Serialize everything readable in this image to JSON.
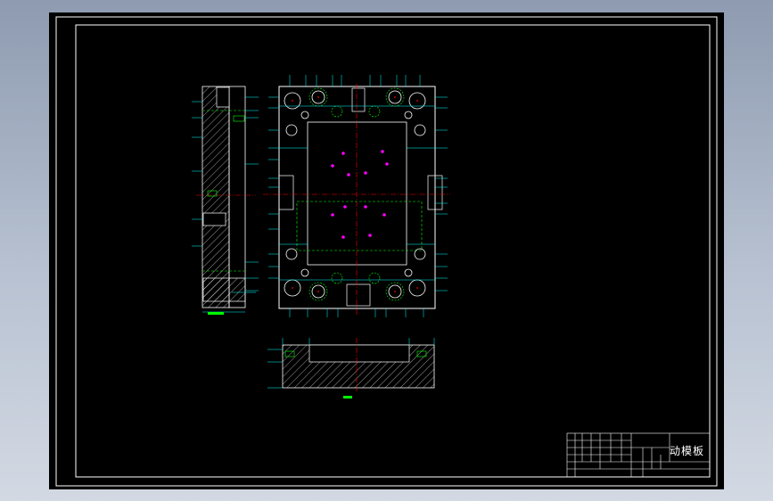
{
  "drawing": {
    "title_block": {
      "part_name": "动模板"
    }
  },
  "colors": {
    "background": "#000000",
    "frame": "#ffffff",
    "outline": "#ffffff",
    "dimension": "#00ffff",
    "centerline": "#ff0000",
    "hidden_line": "#00ff00",
    "hatch": "#ffffff",
    "leader_dot": "#ff00ff",
    "cad_backdrop": "#a8b3c4"
  }
}
